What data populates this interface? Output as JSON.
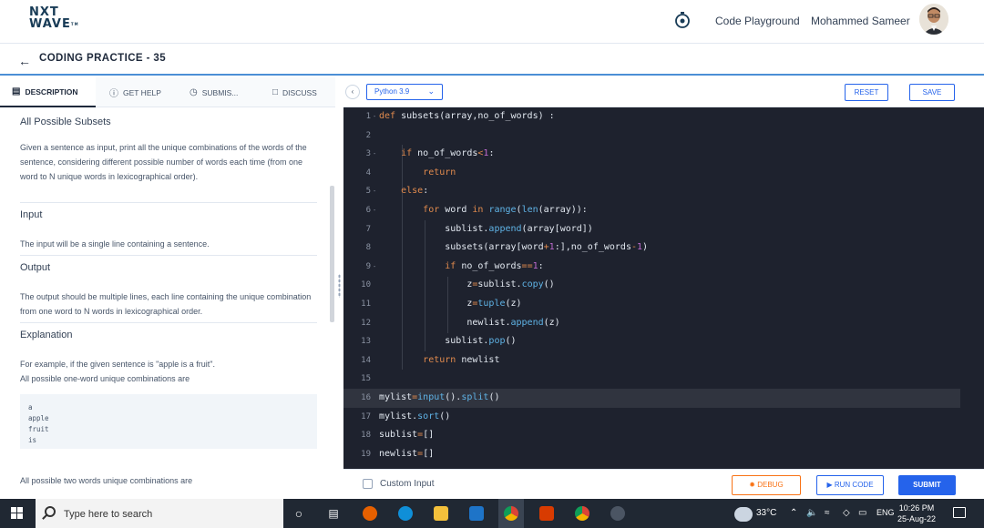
{
  "header": {
    "logo_line1": "NXT",
    "logo_line2": "WAVE",
    "logo_tm": "TM",
    "playground_label": "Code Playground",
    "user_name": "Mohammed Sameer"
  },
  "titlebar": {
    "title": "CODING PRACTICE - 35"
  },
  "tabs": [
    {
      "label": "DESCRIPTION",
      "active": true
    },
    {
      "label": "GET HELP",
      "active": false
    },
    {
      "label": "SUBMIS...",
      "active": false
    },
    {
      "label": "DISCUSS",
      "active": false
    }
  ],
  "problem": {
    "title": "All Possible Subsets",
    "description": "Given a sentence as input, print all the unique combinations of the words of the sentence, considering different possible number of words each time (from one word to N unique words in lexicographical order).",
    "input_heading": "Input",
    "input_text": "The input will be a single line containing a sentence.",
    "output_heading": "Output",
    "output_text": "The output should be multiple lines, each line containing the unique combination from one word to N words in lexicographical order.",
    "explanation_heading": "Explanation",
    "explanation_text1": "For example, if the given sentence is \"apple is a fruit\".",
    "explanation_text2": "All possible one-word unique combinations are",
    "example_block": "a\napple\nfruit\nis",
    "explanation_text3": "All possible two words unique combinations are"
  },
  "editor_toolbar": {
    "language": "Python 3.9",
    "reset_label": "RESET",
    "save_label": "SAVE"
  },
  "code_lines": [
    {
      "n": "1",
      "fold": true,
      "html": "<span class='kw'>def</span> subsets(array,no_of_words) :"
    },
    {
      "n": "2",
      "fold": false,
      "html": ""
    },
    {
      "n": "3",
      "fold": true,
      "html": "    <span class='kw'>if</span> no_of_words<span class='op'>&lt;</span><span class='num'>1</span>:"
    },
    {
      "n": "4",
      "fold": false,
      "html": "        <span class='kw'>return</span>"
    },
    {
      "n": "5",
      "fold": true,
      "html": "    <span class='kw'>else</span>:"
    },
    {
      "n": "6",
      "fold": true,
      "html": "        <span class='kw'>for</span> word <span class='kw'>in</span> <span class='fn'>range</span>(<span class='fn'>len</span>(array)):"
    },
    {
      "n": "7",
      "fold": false,
      "html": "            sublist.<span class='fn'>append</span>(array[word])"
    },
    {
      "n": "8",
      "fold": false,
      "html": "            subsets(array[word<span class='op'>+</span><span class='num'>1</span>:],no_of_words<span class='op'>-</span><span class='num'>1</span>)"
    },
    {
      "n": "9",
      "fold": true,
      "html": "            <span class='kw'>if</span> no_of_words<span class='op'>==</span><span class='num'>1</span>:"
    },
    {
      "n": "10",
      "fold": false,
      "html": "                z<span class='op'>=</span>sublist.<span class='fn'>copy</span>()"
    },
    {
      "n": "11",
      "fold": false,
      "html": "                z<span class='op'>=</span><span class='fn'>tuple</span>(z)"
    },
    {
      "n": "12",
      "fold": false,
      "html": "                newlist.<span class='fn'>append</span>(z)"
    },
    {
      "n": "13",
      "fold": false,
      "html": "            sublist.<span class='fn'>pop</span>()"
    },
    {
      "n": "14",
      "fold": false,
      "html": "        <span class='kw'>return</span> newlist"
    },
    {
      "n": "15",
      "fold": false,
      "html": ""
    },
    {
      "n": "16",
      "fold": false,
      "highlight": true,
      "html": "mylist<span class='op'>=</span><span class='fn'>input</span>().<span class='fn'>split</span>()"
    },
    {
      "n": "17",
      "fold": false,
      "html": "mylist.<span class='fn'>sort</span>()"
    },
    {
      "n": "18",
      "fold": false,
      "html": "sublist<span class='op'>=</span>[]"
    },
    {
      "n": "19",
      "fold": false,
      "html": "newlist<span class='op'>=</span>[]"
    }
  ],
  "editor_footer": {
    "custom_input_label": "Custom Input",
    "debug_label": "DEBUG",
    "run_label": "RUN CODE",
    "submit_label": "SUBMIT"
  },
  "taskbar": {
    "search_placeholder": "Type here to search",
    "temperature": "33°C",
    "language": "ENG",
    "time": "10:26 PM",
    "date": "25-Aug-22"
  },
  "colors": {
    "accent": "#2563eb",
    "editor_bg": "#1e222e",
    "debug": "#f97316"
  }
}
